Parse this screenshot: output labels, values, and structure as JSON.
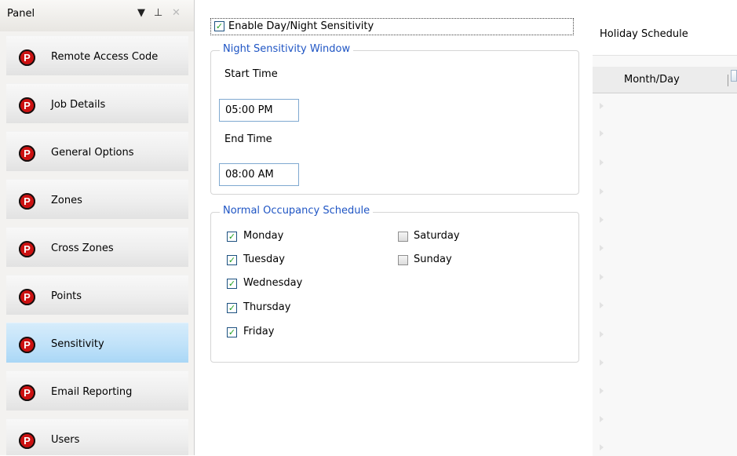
{
  "panel": {
    "title": "Panel",
    "items": [
      {
        "label": "Remote Access Code",
        "icon": "p-icon"
      },
      {
        "label": "Job Details",
        "icon": "p-icon"
      },
      {
        "label": "General Options",
        "icon": "p-icon"
      },
      {
        "label": "Zones",
        "icon": "p-icon"
      },
      {
        "label": "Cross Zones",
        "icon": "p-icon"
      },
      {
        "label": "Points",
        "icon": "p-icon"
      },
      {
        "label": "Sensitivity",
        "icon": "p-icon",
        "selected": true
      },
      {
        "label": "Email Reporting",
        "icon": "p-icon"
      },
      {
        "label": "Users",
        "icon": "p-icon"
      }
    ]
  },
  "sensitivity": {
    "enable_label": "Enable Day/Night Sensitivity",
    "enable_checked": true,
    "night_window": {
      "title": "Night Sensitivity Window",
      "start_label": "Start Time",
      "start_value": "05:00 PM",
      "end_label": "End Time",
      "end_value": "08:00 AM"
    },
    "occupancy": {
      "title": "Normal Occupancy Schedule",
      "days": [
        {
          "label": "Monday",
          "checked": true
        },
        {
          "label": "Tuesday",
          "checked": true
        },
        {
          "label": "Wednesday",
          "checked": true
        },
        {
          "label": "Thursday",
          "checked": true
        },
        {
          "label": "Friday",
          "checked": true
        },
        {
          "label": "Saturday",
          "checked": false
        },
        {
          "label": "Sunday",
          "checked": false
        }
      ]
    }
  },
  "holiday": {
    "title": "Holiday Schedule",
    "column_header": "Month/Day"
  },
  "colors": {
    "accent_blue": "#1f55c4",
    "selected_item": "#c0e2f9",
    "check_green": "#21a121",
    "icon_red": "#cc1111"
  }
}
